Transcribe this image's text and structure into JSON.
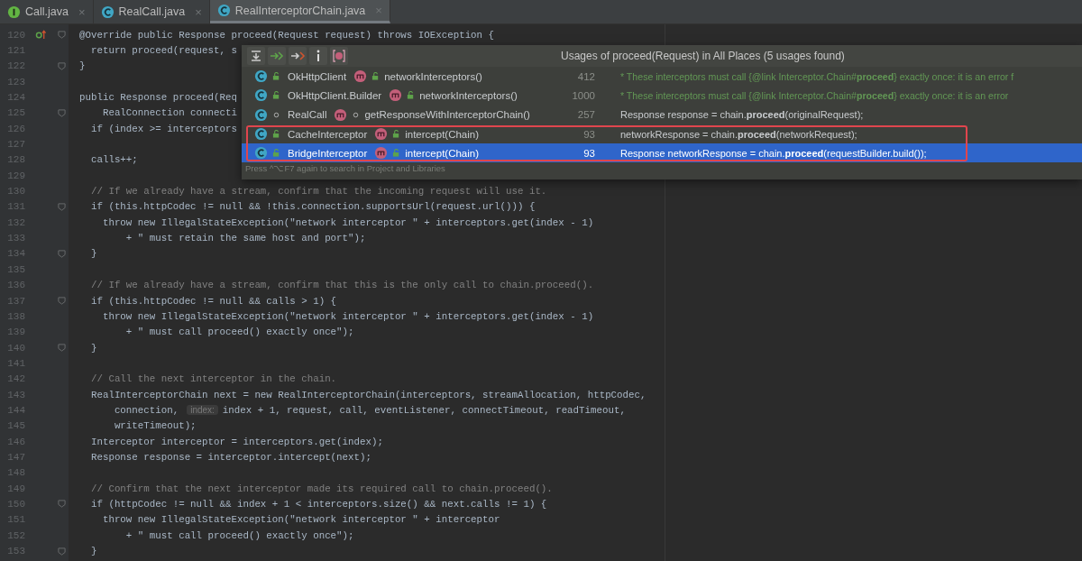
{
  "tabs": [
    {
      "label": "Call.java",
      "kind": "interface",
      "selected": false,
      "close": "×"
    },
    {
      "label": "RealCall.java",
      "kind": "class",
      "selected": false,
      "close": "×"
    },
    {
      "label": "RealInterceptorChain.java",
      "kind": "class",
      "selected": true,
      "close": "×"
    }
  ],
  "editor": {
    "lines": [
      {
        "n": "120",
        "text": "@Override public Response proceed(Request request) throws IOException {",
        "kind": "code",
        "fold": true,
        "override": true
      },
      {
        "n": "121",
        "text": "  return proceed(request, s",
        "kind": "code",
        "fold": false,
        "override": false
      },
      {
        "n": "122",
        "text": "}",
        "kind": "code",
        "fold": true,
        "override": false
      },
      {
        "n": "123",
        "fold": false,
        "override": false
      },
      {
        "n": "124",
        "text": "public Response proceed(Req",
        "kind": "code",
        "fold": false,
        "override": false
      },
      {
        "n": "125",
        "text": "    RealConnection connecti",
        "kind": "code",
        "fold": true,
        "override": false
      },
      {
        "n": "126",
        "text": "  if (index >= interceptors",
        "kind": "code",
        "fold": false,
        "override": false
      },
      {
        "n": "127",
        "fold": false,
        "override": false
      },
      {
        "n": "128",
        "text": "  calls++;",
        "kind": "code",
        "fold": false,
        "override": false
      },
      {
        "n": "129",
        "fold": false,
        "override": false
      },
      {
        "n": "130",
        "text": "  // If we already have a stream, confirm that the incoming request will use it.",
        "kind": "comment",
        "fold": false,
        "override": false
      },
      {
        "n": "131",
        "text": "  if (this.httpCodec != null && !this.connection.supportsUrl(request.url())) {",
        "kind": "code",
        "fold": true,
        "override": false
      },
      {
        "n": "132",
        "text": "    throw new IllegalStateException(\"network interceptor \" + interceptors.get(index - 1)",
        "kind": "code",
        "fold": false,
        "override": false
      },
      {
        "n": "133",
        "text": "        + \" must retain the same host and port\");",
        "kind": "code",
        "fold": false,
        "override": false
      },
      {
        "n": "134",
        "text": "  }",
        "kind": "code",
        "fold": true,
        "override": false
      },
      {
        "n": "135",
        "fold": false,
        "override": false
      },
      {
        "n": "136",
        "text": "  // If we already have a stream, confirm that this is the only call to chain.proceed().",
        "kind": "comment",
        "fold": false,
        "override": false
      },
      {
        "n": "137",
        "text": "  if (this.httpCodec != null && calls > 1) {",
        "kind": "code",
        "fold": true,
        "override": false
      },
      {
        "n": "138",
        "text": "    throw new IllegalStateException(\"network interceptor \" + interceptors.get(index - 1)",
        "kind": "code",
        "fold": false,
        "override": false
      },
      {
        "n": "139",
        "text": "        + \" must call proceed() exactly once\");",
        "kind": "code",
        "fold": false,
        "override": false
      },
      {
        "n": "140",
        "text": "  }",
        "kind": "code",
        "fold": true,
        "override": false
      },
      {
        "n": "141",
        "fold": false,
        "override": false
      },
      {
        "n": "142",
        "text": "  // Call the next interceptor in the chain.",
        "kind": "comment",
        "fold": false,
        "override": false
      },
      {
        "n": "143",
        "text": "  RealInterceptorChain next = new RealInterceptorChain(interceptors, streamAllocation, httpCodec,",
        "kind": "code",
        "fold": false,
        "override": false
      },
      {
        "n": "144",
        "text": "      connection,",
        "hint": "index:",
        "rest": "index + 1, request, call, eventListener, connectTimeout, readTimeout,",
        "kind": "code",
        "fold": false,
        "override": false
      },
      {
        "n": "145",
        "text": "      writeTimeout);",
        "kind": "code",
        "fold": false,
        "override": false
      },
      {
        "n": "146",
        "text": "  Interceptor interceptor = interceptors.get(index);",
        "kind": "code",
        "fold": false,
        "override": false
      },
      {
        "n": "147",
        "text": "  Response response = interceptor.intercept(next);",
        "kind": "code",
        "fold": false,
        "override": false
      },
      {
        "n": "148",
        "fold": false,
        "override": false
      },
      {
        "n": "149",
        "text": "  // Confirm that the next interceptor made its required call to chain.proceed().",
        "kind": "comment",
        "fold": false,
        "override": false
      },
      {
        "n": "150",
        "text": "  if (httpCodec != null && index + 1 < interceptors.size() && next.calls != 1) {",
        "kind": "code",
        "fold": true,
        "override": false
      },
      {
        "n": "151",
        "text": "    throw new IllegalStateException(\"network interceptor \" + interceptor",
        "kind": "code",
        "fold": false,
        "override": false
      },
      {
        "n": "152",
        "text": "        + \" must call proceed() exactly once\");",
        "kind": "code",
        "fold": false,
        "override": false
      },
      {
        "n": "153",
        "text": "  }",
        "kind": "code",
        "fold": true,
        "override": false
      }
    ]
  },
  "usages_popup": {
    "title": "Usages of proceed(Request) in All Places (5 usages found)",
    "rows": [
      {
        "class": "OkHttpClient",
        "package_private": false,
        "method": "networkInterceptors()",
        "line": "412",
        "code": "* These interceptors must call {@link Interceptor.Chain#**proceed**} exactly once: it is an error f",
        "kind": "comment",
        "selected": false,
        "boxed": false
      },
      {
        "class": "OkHttpClient.Builder",
        "package_private": false,
        "method": "networkInterceptors()",
        "line": "1000",
        "code": "* These interceptors must call {@link Interceptor.Chain#**proceed**} exactly once: it is an error",
        "kind": "comment",
        "selected": false,
        "boxed": false
      },
      {
        "class": "RealCall",
        "package_private": true,
        "method": "getResponseWithInterceptorChain()",
        "line": "257",
        "code": "Response response = chain.**proceed**(originalRequest);",
        "kind": "code",
        "selected": false,
        "boxed": false
      },
      {
        "class": "CacheInterceptor",
        "package_private": false,
        "method": "intercept(Chain)",
        "line": "93",
        "code": "networkResponse = chain.**proceed**(networkRequest);",
        "kind": "code",
        "selected": false,
        "boxed": true
      },
      {
        "class": "BridgeInterceptor",
        "package_private": false,
        "method": "intercept(Chain)",
        "line": "93",
        "code": "Response networkResponse = chain.**proceed**(requestBuilder.build());",
        "kind": "code",
        "selected": true,
        "boxed": true
      }
    ],
    "footer": "Press ^⌥F7 again to search in Project and Libraries"
  }
}
